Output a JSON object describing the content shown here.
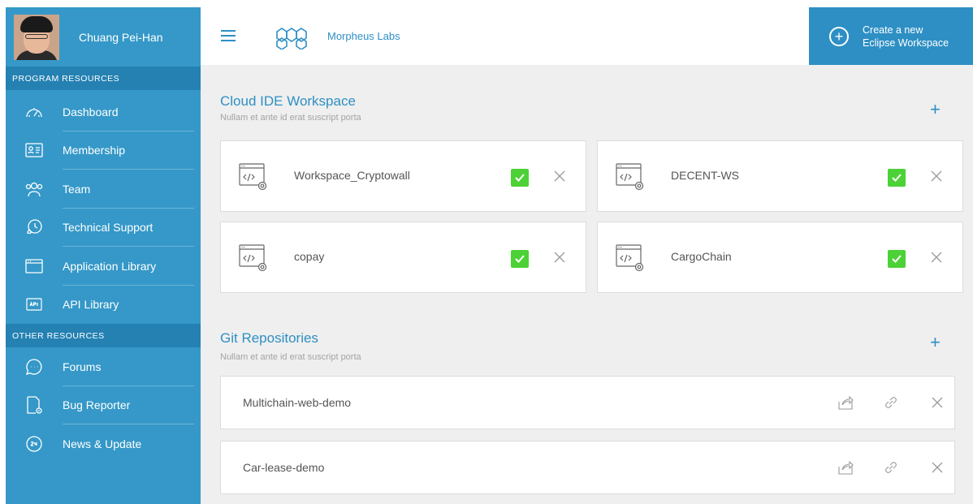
{
  "profile": {
    "name": "Chuang Pei-Han"
  },
  "sidebar": {
    "program_heading": "PROGRAM RESOURCES",
    "program_items": [
      {
        "label": "Dashboard",
        "icon": "speedometer-icon"
      },
      {
        "label": "Membership",
        "icon": "id-card-icon"
      },
      {
        "label": "Team",
        "icon": "team-icon"
      },
      {
        "label": "Technical Support",
        "icon": "support-icon"
      },
      {
        "label": "Application Library",
        "icon": "window-icon"
      },
      {
        "label": "API Library",
        "icon": "api-icon"
      }
    ],
    "other_heading": "OTHER RESOURCES",
    "other_items": [
      {
        "label": "Forums",
        "icon": "chat-bubble-icon"
      },
      {
        "label": "Bug Reporter",
        "icon": "bug-report-icon"
      },
      {
        "label": "News & Update",
        "icon": "news-icon"
      }
    ]
  },
  "header": {
    "brand": "Morpheus Labs",
    "create_button": {
      "line1": "Create a new",
      "line2": "Eclipse Workspace"
    }
  },
  "workspaces_section": {
    "title": "Cloud IDE Workspace",
    "subtitle": "Nullam et ante id erat suscript porta",
    "items": [
      {
        "name": "Workspace_Cryptowall"
      },
      {
        "name": "DECENT-WS"
      },
      {
        "name": "copay"
      },
      {
        "name": "CargoChain"
      }
    ]
  },
  "repos_section": {
    "title": "Git Repositories",
    "subtitle": "Nullam et ante id erat suscript porta",
    "items": [
      {
        "name": "Multichain-web-demo"
      },
      {
        "name": "Car-lease-demo"
      }
    ]
  },
  "colors": {
    "sidebar": "#3598c8",
    "sidebar_heading": "#2481b2",
    "accent": "#2e8fc4",
    "check": "#4cd137",
    "background": "#efefef"
  }
}
